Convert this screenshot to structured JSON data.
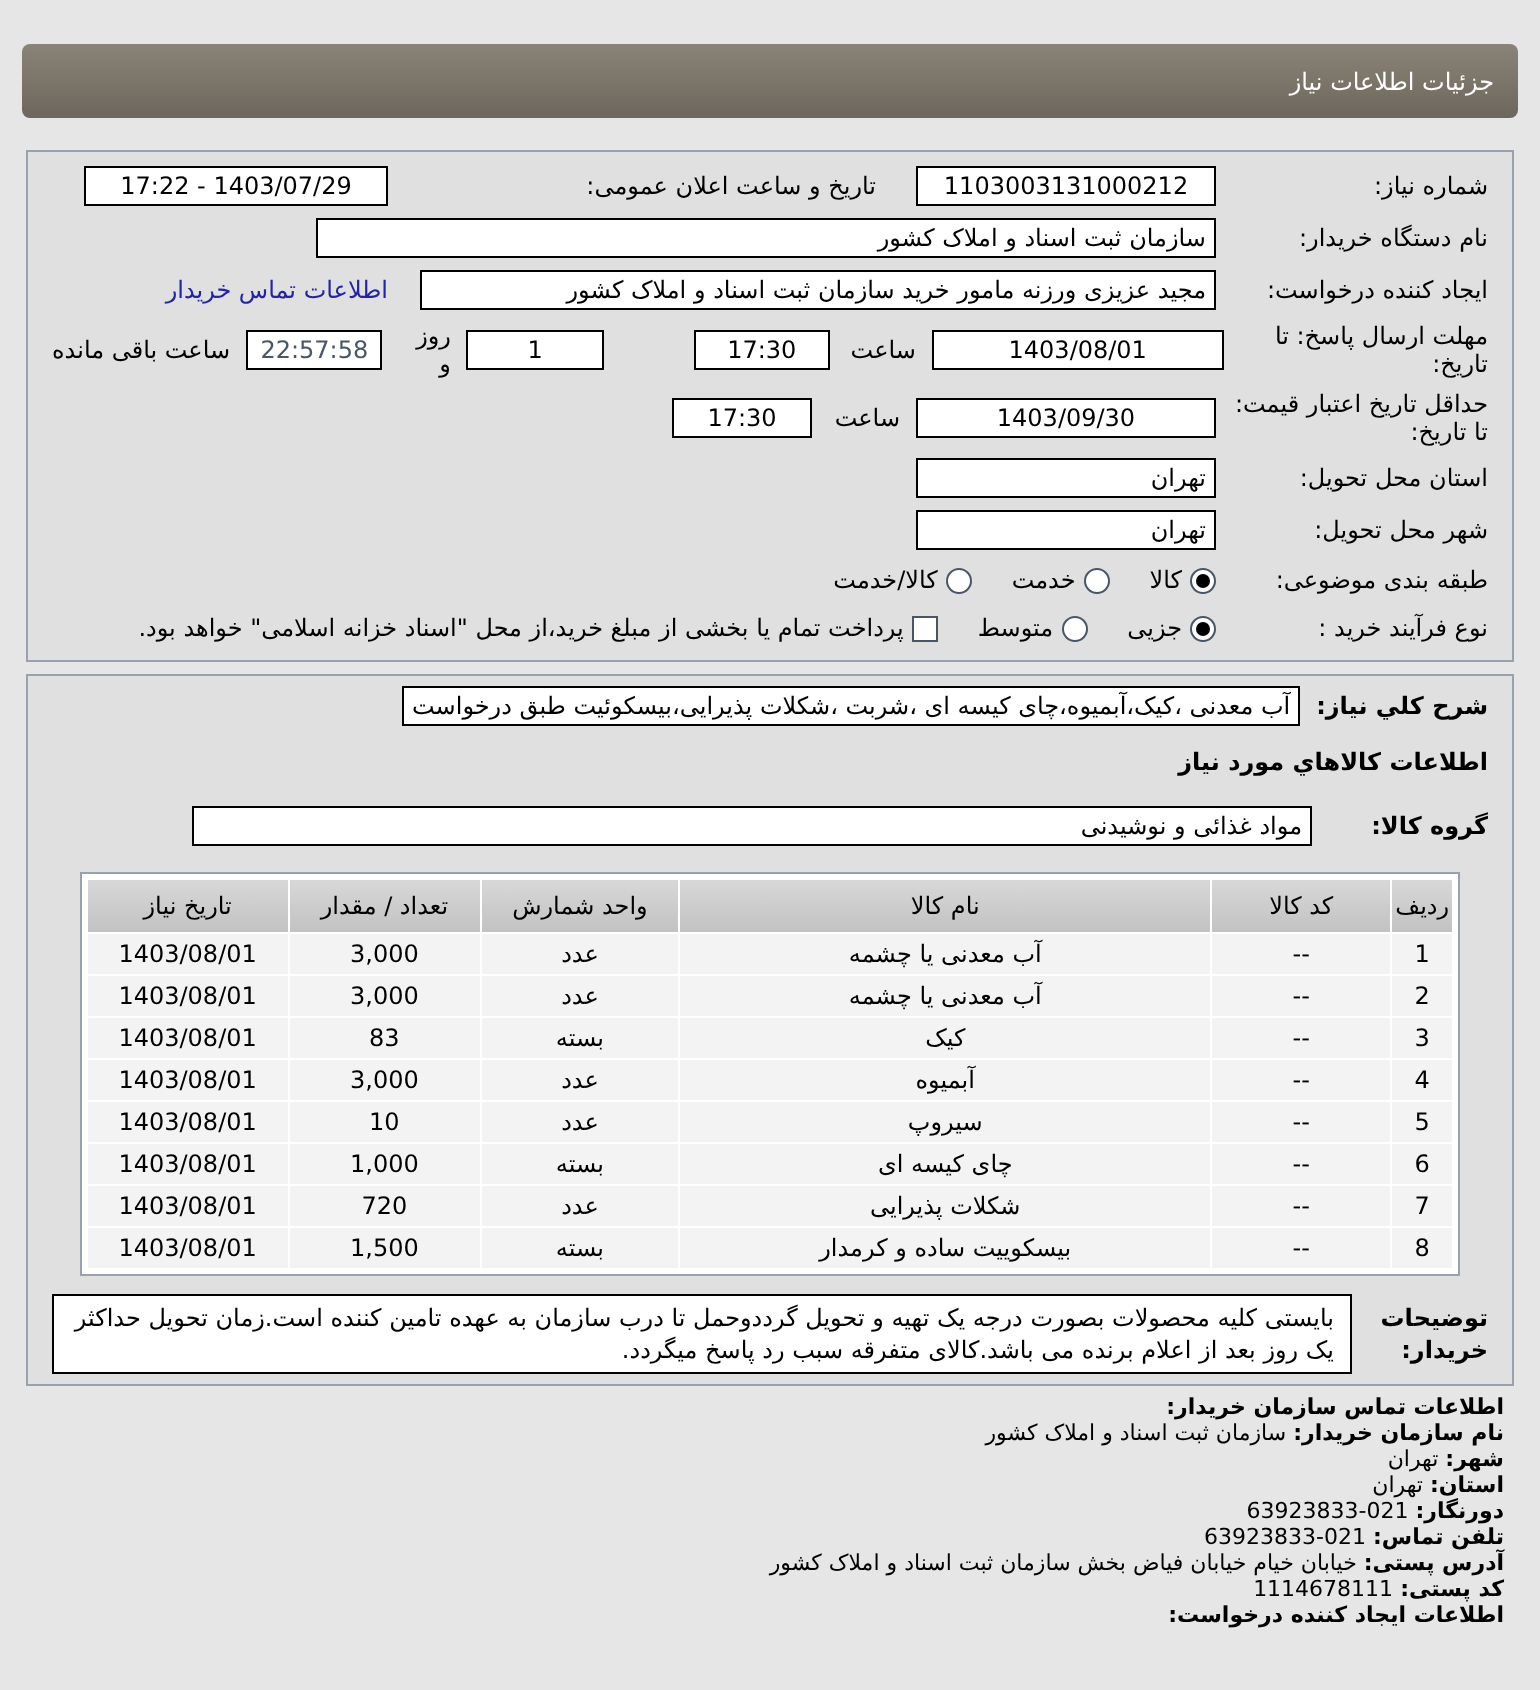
{
  "header": {
    "title": "جزئیات اطلاعات نیاز"
  },
  "request_number": {
    "label": "شماره نیاز:",
    "value": "1103003131000212"
  },
  "announce": {
    "label": "تاریخ و ساعت اعلان عمومی:",
    "value": "1403/07/29 - 17:22"
  },
  "buyer_org": {
    "label": "نام دستگاه خریدار:",
    "value": "سازمان ثبت اسناد و املاک کشور"
  },
  "creator": {
    "label": "ایجاد کننده درخواست:",
    "value": "مجید عزیزی ورزنه مامور خرید سازمان ثبت اسناد و املاک کشور",
    "link": "اطلاعات تماس خریدار"
  },
  "deadline": {
    "label": "مهلت ارسال پاسخ: تا تاریخ:",
    "date": "1403/08/01",
    "time_label": "ساعت",
    "time": "17:30",
    "days": "1",
    "days_label": "روز و",
    "remaining": "22:57:58",
    "remaining_label": "ساعت باقی مانده"
  },
  "validity": {
    "label": "حداقل تاریخ اعتبار قیمت: تا تاریخ:",
    "date": "1403/09/30",
    "time_label": "ساعت",
    "time": "17:30"
  },
  "province": {
    "label": "استان محل تحویل:",
    "value": "تهران"
  },
  "city": {
    "label": "شهر محل تحویل:",
    "value": "تهران"
  },
  "category": {
    "label": "طبقه بندی موضوعی:",
    "options": [
      {
        "label": "کالا",
        "selected": true
      },
      {
        "label": "خدمت",
        "selected": false
      },
      {
        "label": "کالا/خدمت",
        "selected": false
      }
    ]
  },
  "process": {
    "label": "نوع فرآیند خرید :",
    "options": [
      {
        "label": "جزیی",
        "selected": true
      },
      {
        "label": "متوسط",
        "selected": false
      }
    ],
    "payment": {
      "label": "پرداخت تمام یا بخشی از مبلغ خرید،از محل \"اسناد خزانه اسلامی\" خواهد بود.",
      "checked": false
    }
  },
  "description": {
    "label": "شرح کلي نياز:",
    "value": "آب معدنی ،کیک،آبمیوه،چای کیسه ای ،شربت ،شکلات پذیرایی،بیسکوئیت طبق درخواست"
  },
  "items_title": "اطلاعات کالاهاي مورد نياز",
  "goods_group": {
    "label": "گروه کالا:",
    "value": "مواد غذائی و نوشیدنی"
  },
  "table": {
    "columns": [
      "ردیف",
      "کد کالا",
      "نام کالا",
      "واحد شمارش",
      "تعداد / مقدار",
      "تاریخ نیاز"
    ],
    "rows": [
      [
        "1",
        "--",
        "آب معدنی یا چشمه",
        "عدد",
        "3,000",
        "1403/08/01"
      ],
      [
        "2",
        "--",
        "آب معدنی یا چشمه",
        "عدد",
        "3,000",
        "1403/08/01"
      ],
      [
        "3",
        "--",
        "کیک",
        "بسته",
        "83",
        "1403/08/01"
      ],
      [
        "4",
        "--",
        "آبمیوه",
        "عدد",
        "3,000",
        "1403/08/01"
      ],
      [
        "5",
        "--",
        "سیروپ",
        "عدد",
        "10",
        "1403/08/01"
      ],
      [
        "6",
        "--",
        "چای کیسه ای",
        "بسته",
        "1,000",
        "1403/08/01"
      ],
      [
        "7",
        "--",
        "شکلات پذیرایی",
        "عدد",
        "720",
        "1403/08/01"
      ],
      [
        "8",
        "--",
        "بیسکوییت ساده و کرمدار",
        "بسته",
        "1,500",
        "1403/08/01"
      ]
    ]
  },
  "notes": {
    "label": "توضیحات خریدار:",
    "value": "بایستی کلیه محصولات بصورت درجه یک تهیه و تحویل گرددوحمل تا درب سازمان به عهده تامین کننده است.زمان تحویل حداکثر یک روز بعد از اعلام برنده می باشد.کالای متفرقه سبب رد پاسخ میگردد."
  },
  "contact": {
    "title": "اطلاعات تماس سازمان خریدار:",
    "lines": [
      {
        "label": "نام سازمان خریدار:",
        "value": "سازمان ثبت اسناد و املاک کشور"
      },
      {
        "label": "شهر:",
        "value": "تهران"
      },
      {
        "label": "استان:",
        "value": "تهران"
      },
      {
        "label": "دورنگار:",
        "value": "021-63923833"
      },
      {
        "label": "تلفن تماس:",
        "value": "021-63923833"
      },
      {
        "label": "آدرس پستی:",
        "value": "خیابان خیام خیابان فیاض بخش سازمان ثبت اسناد و املاک کشور"
      },
      {
        "label": "کد پستی:",
        "value": "1114678111"
      }
    ],
    "next_title": "اطلاعات ایجاد کننده درخواست:"
  }
}
